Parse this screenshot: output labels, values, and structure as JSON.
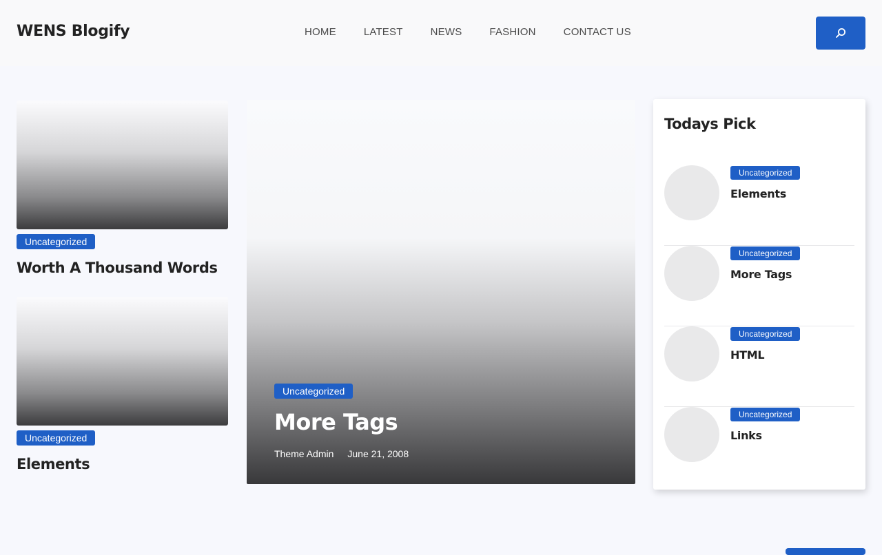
{
  "header": {
    "brand": "WENS Blogify",
    "nav": [
      "HOME",
      "LATEST",
      "NEWS",
      "FASHION",
      "CONTACT US"
    ],
    "search_icon": "search-icon"
  },
  "colors": {
    "accent": "#1f5fc6",
    "background": "#f7f8fd",
    "header_bg": "#f9f9fa"
  },
  "left_posts": [
    {
      "category": "Uncategorized",
      "title": "Worth A Thousand Words"
    },
    {
      "category": "Uncategorized",
      "title": "Elements"
    }
  ],
  "featured": {
    "category": "Uncategorized",
    "title": "More Tags",
    "author": "Theme Admin",
    "date": "June 21, 2008"
  },
  "sidebar": {
    "title": "Todays Pick",
    "items": [
      {
        "category": "Uncategorized",
        "title": "Elements"
      },
      {
        "category": "Uncategorized",
        "title": "More Tags"
      },
      {
        "category": "Uncategorized",
        "title": "HTML"
      },
      {
        "category": "Uncategorized",
        "title": "Links"
      }
    ]
  }
}
